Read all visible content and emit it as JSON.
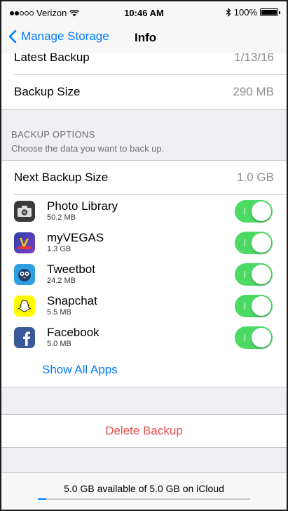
{
  "status_bar": {
    "carrier": "Verizon",
    "time": "10:46 AM",
    "battery": "100%",
    "battery_level": 1.0,
    "signal_bars_filled": 2,
    "signal_bars_total": 5
  },
  "nav": {
    "back_label": "Manage Storage",
    "title": "Info"
  },
  "backup_info": {
    "latest_label": "Latest Backup",
    "latest_value": "1/13/16",
    "size_label": "Backup Size",
    "size_value": "290 MB"
  },
  "backup_options": {
    "title": "BACKUP OPTIONS",
    "subtitle": "Choose the data you want to back up.",
    "next_label": "Next Backup Size",
    "next_value": "1.0 GB",
    "apps": [
      {
        "name": "Photo Library",
        "size": "50.2 MB",
        "enabled": true,
        "icon": "camera-icon"
      },
      {
        "name": "myVEGAS",
        "size": "1.3 GB",
        "enabled": true,
        "icon": "myvegas-icon"
      },
      {
        "name": "Tweetbot",
        "size": "24.2 MB",
        "enabled": true,
        "icon": "tweetbot-icon"
      },
      {
        "name": "Snapchat",
        "size": "5.5 MB",
        "enabled": true,
        "icon": "snapchat-ghost-icon"
      },
      {
        "name": "Facebook",
        "size": "5.0 MB",
        "enabled": true,
        "icon": "facebook-icon"
      }
    ],
    "show_all": "Show All Apps"
  },
  "delete_label": "Delete Backup",
  "footer": {
    "text": "5.0 GB available of 5.0 GB on iCloud",
    "used_fraction": 0.04
  },
  "colors": {
    "accent": "#007aff",
    "toggle_on": "#4cd964",
    "destructive": "#e4504a"
  }
}
